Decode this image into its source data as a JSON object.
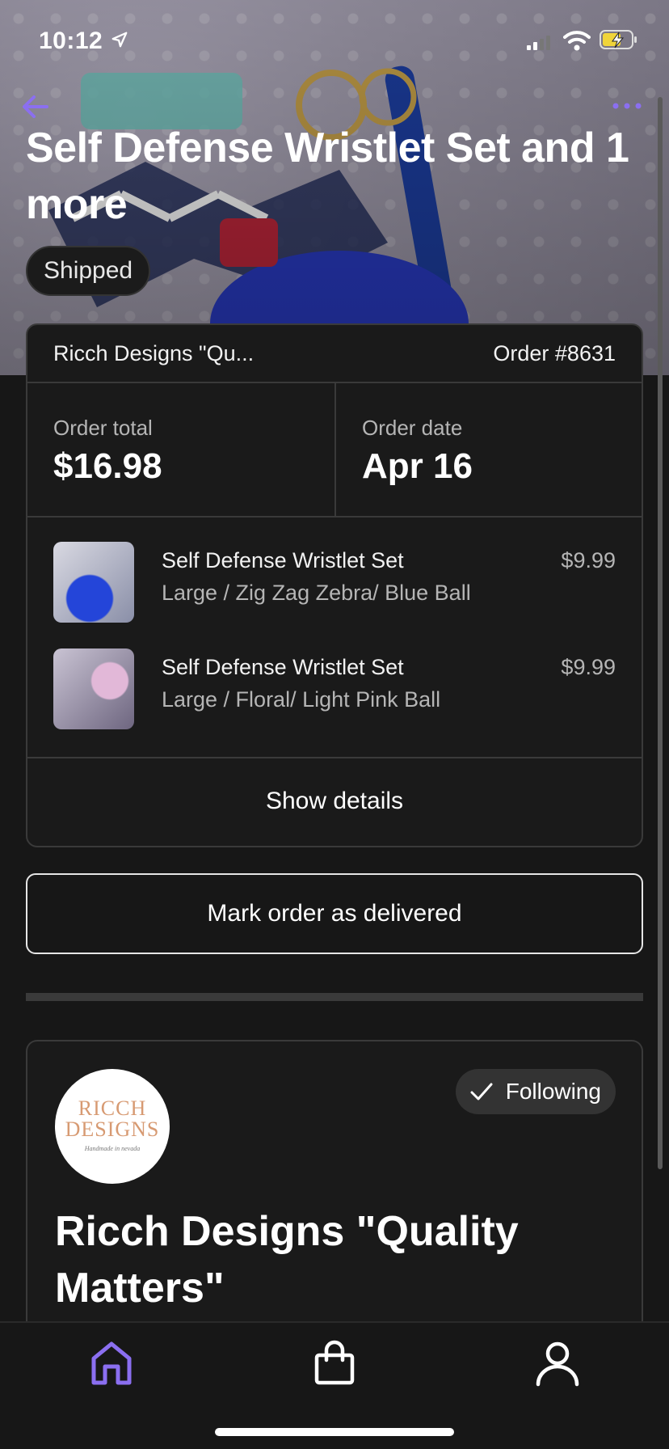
{
  "status": {
    "time": "10:12"
  },
  "header": {
    "title": "Self Defense Wristlet Set and 1 more",
    "badge": "Shipped"
  },
  "order": {
    "shop_name": "Ricch Designs \"Qu...",
    "order_number": "Order #8631",
    "total_label": "Order total",
    "total_value": "$16.98",
    "date_label": "Order date",
    "date_value": "Apr 16",
    "items": [
      {
        "name": "Self Defense Wristlet Set",
        "variant": "Large / Zig Zag Zebra/ Blue Ball",
        "price": "$9.99"
      },
      {
        "name": "Self Defense Wristlet Set",
        "variant": "Large / Floral/ Light Pink Ball",
        "price": "$9.99"
      }
    ],
    "details_label": "Show details"
  },
  "actions": {
    "mark_delivered": "Mark order as delivered"
  },
  "shop": {
    "logo_line1": "RICCH",
    "logo_line2": "DESIGNS",
    "logo_tagline": "Handmade in nevada",
    "follow_label": "Following",
    "title": "Ricch Designs \"Quality Matters\""
  },
  "colors": {
    "accent": "#8b6ff0",
    "background": "#171717",
    "card_border": "#3a3a3a"
  },
  "icons": [
    "location-arrow-icon",
    "signal-icon",
    "wifi-icon",
    "battery-charging-icon",
    "back-arrow-icon",
    "more-icon",
    "check-icon",
    "home-icon",
    "bag-icon",
    "profile-icon"
  ]
}
